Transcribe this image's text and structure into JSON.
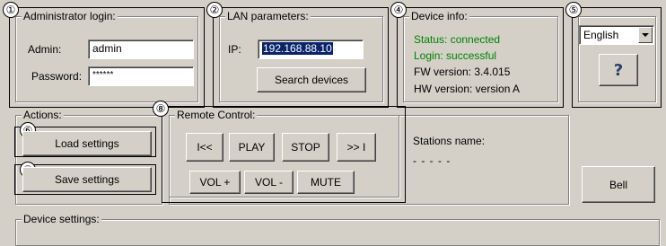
{
  "callouts": [
    "①",
    "②",
    "④",
    "⑤",
    "⑥",
    "⑦",
    "⑧"
  ],
  "admin": {
    "title": "Administrator login:",
    "admin_label": "Admin:",
    "admin_value": "admin",
    "password_label": "Password:",
    "password_value": "******"
  },
  "lan": {
    "title": "LAN parameters:",
    "ip_label": "IP:",
    "ip_value": "192.168.88.10",
    "search_button": "Search devices"
  },
  "device_info": {
    "title": "Device info:",
    "status": "Status: connected",
    "login": "Login: successful",
    "fw": "FW version: 3.4.015",
    "hw": "HW version: version A",
    "status_color": "#008000"
  },
  "language": {
    "selected": "English",
    "help_label": "?"
  },
  "actions": {
    "title": "Actions:",
    "load_button": "Load settings",
    "save_button": "Save settings"
  },
  "remote": {
    "title": "Remote Control:",
    "prev_button": "I<<",
    "play_button": "PLAY",
    "stop_button": "STOP",
    "next_button": ">> I",
    "vol_up_button": "VOL +",
    "vol_down_button": "VOL -",
    "mute_button": "MUTE"
  },
  "stations": {
    "label": "Stations name:",
    "value": "- - - - -"
  },
  "bell_button": "Bell",
  "device_settings": {
    "title": "Device settings:"
  }
}
